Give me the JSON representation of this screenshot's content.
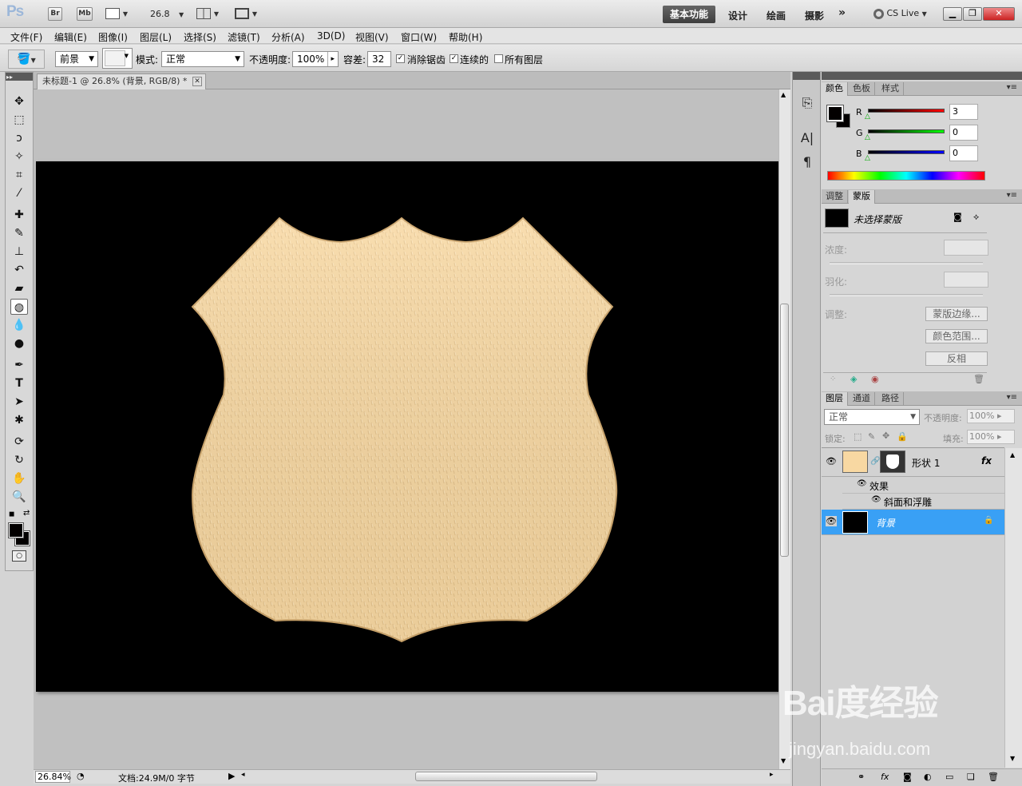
{
  "app": {
    "logo": "Ps",
    "bridge": "Br",
    "minibridge": "Mb",
    "zoom": "26.8",
    "workspaces": [
      "基本功能",
      "设计",
      "绘画",
      "摄影"
    ],
    "more": "»",
    "cslive": "CS Live"
  },
  "menu": [
    "文件(F)",
    "编辑(E)",
    "图像(I)",
    "图层(L)",
    "选择(S)",
    "滤镜(T)",
    "分析(A)",
    "3D(D)",
    "视图(V)",
    "窗口(W)",
    "帮助(H)"
  ],
  "options": {
    "fill_source": "前景",
    "mode_label": "模式:",
    "mode_value": "正常",
    "opacity_label": "不透明度:",
    "opacity_value": "100%",
    "tolerance_label": "容差:",
    "tolerance_value": "32",
    "antialias": "消除锯齿",
    "contiguous": "连续的",
    "all_layers": "所有图层"
  },
  "document": {
    "tab_title": "未标题-1 @ 26.8% (背景, RGB/8) *",
    "zoom_status": "26.84%",
    "doc_info": "文档:24.9M/0 字节",
    "shape_fill": "#fbd9a3"
  },
  "color_panel": {
    "tabs": [
      "颜色",
      "色板",
      "样式"
    ],
    "r_label": "R",
    "g_label": "G",
    "b_label": "B",
    "r": "3",
    "g": "0",
    "b": "0"
  },
  "masks_panel": {
    "tabs": [
      "调整",
      "蒙版"
    ],
    "no_mask": "未选择蒙版",
    "density": "浓度:",
    "feather": "羽化:",
    "refine": "调整:",
    "mask_edge": "蒙版边缘...",
    "color_range": "颜色范围...",
    "invert": "反相"
  },
  "layers_panel": {
    "tabs": [
      "图层",
      "通道",
      "路径"
    ],
    "blend": "正常",
    "opacity_label": "不透明度:",
    "opacity_value": "100%",
    "lock_label": "锁定:",
    "fill_label": "填充:",
    "fill_value": "100%",
    "layer1_name": "形状 1",
    "fx": "fx",
    "effects": "效果",
    "bevel": "斜面和浮雕",
    "bg_name": "背景"
  },
  "watermark": {
    "logo": "Bai度经验",
    "url": "jingyan.baidu.com"
  }
}
